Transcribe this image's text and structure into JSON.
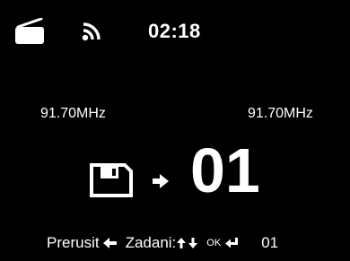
{
  "status_bar": {
    "time": "02:18",
    "icons": [
      "radio-icon",
      "rss-icon"
    ]
  },
  "frequency": {
    "left": "91.70MHz",
    "right": "91.70MHz"
  },
  "preset": {
    "icons": [
      "floppy-disk-save-icon",
      "arrow-right-icon"
    ],
    "number": "01"
  },
  "hints": {
    "cancel_label": "Prerusit",
    "enter_label": "Zadani:",
    "ok_label": "OK",
    "preset_number": "01",
    "icons": [
      "arrow-left-icon",
      "arrow-up-icon",
      "arrow-down-icon",
      "enter-return-icon"
    ]
  },
  "colors": {
    "background": "#000000",
    "foreground": "#ffffff"
  }
}
